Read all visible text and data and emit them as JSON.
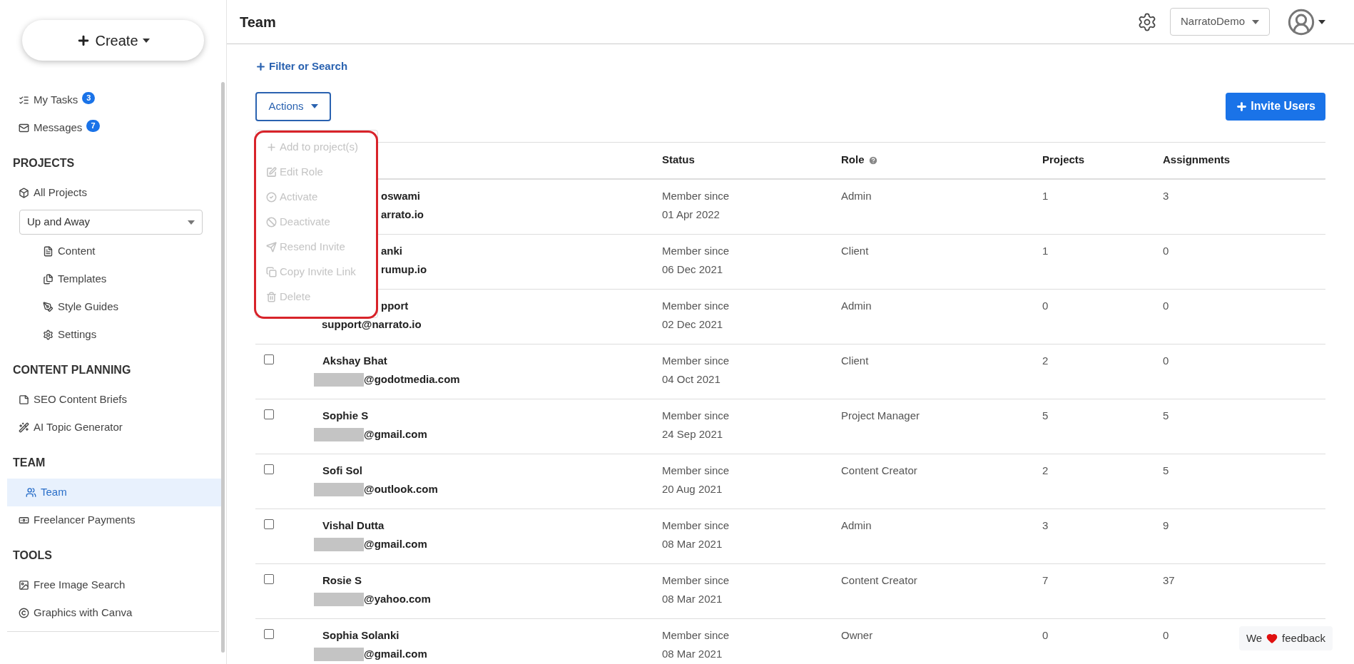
{
  "sidebar": {
    "create_button": "Create",
    "items": [
      {
        "kind": "link",
        "label": "My Tasks",
        "badge": "3",
        "selected": false
      },
      {
        "kind": "link",
        "label": "Messages",
        "badge": "7",
        "selected": false
      },
      {
        "kind": "heading",
        "label": "PROJECTS"
      },
      {
        "kind": "link",
        "label": "All Projects",
        "selected": false
      },
      {
        "kind": "select",
        "value": "Up and Away"
      },
      {
        "kind": "subitem",
        "label": "Content",
        "selected": false
      },
      {
        "kind": "subitem",
        "label": "Templates",
        "selected": false
      },
      {
        "kind": "subitem",
        "label": "Style Guides",
        "selected": false
      },
      {
        "kind": "subitem",
        "label": "Settings",
        "selected": false
      },
      {
        "kind": "heading",
        "label": "CONTENT PLANNING"
      },
      {
        "kind": "link",
        "label": "SEO Content Briefs",
        "selected": false
      },
      {
        "kind": "link",
        "label": "AI Topic Generator",
        "selected": false
      },
      {
        "kind": "heading",
        "label": "TEAM"
      },
      {
        "kind": "link",
        "label": "Team",
        "selected": true
      },
      {
        "kind": "link",
        "label": "Freelancer Payments",
        "selected": false
      },
      {
        "kind": "heading",
        "label": "TOOLS"
      },
      {
        "kind": "link",
        "label": "Free Image Search",
        "selected": false
      },
      {
        "kind": "link",
        "label": "Graphics with Canva",
        "selected": false
      }
    ]
  },
  "header": {
    "title": "Team",
    "workspace": "NarratoDemo"
  },
  "filter_link": "Filter or Search",
  "actions_button": "Actions",
  "invite_button": "Invite Users",
  "actions_menu": {
    "items": [
      {
        "label": "Add to project(s)",
        "disabled": true
      },
      {
        "label": "Edit Role",
        "disabled": true
      },
      {
        "label": "Activate",
        "disabled": true
      },
      {
        "label": "Deactivate",
        "disabled": true
      },
      {
        "label": "Resend Invite",
        "disabled": true
      },
      {
        "label": "Copy Invite Link",
        "disabled": true
      },
      {
        "label": "Delete",
        "disabled": true
      }
    ]
  },
  "table": {
    "columns": [
      "Status",
      "Role",
      "Projects",
      "Assignments"
    ],
    "rows": [
      {
        "name": "oswami",
        "name_clipped": true,
        "email": "arrato.io",
        "email_clipped": true,
        "redacted": false,
        "status": [
          "Member since",
          "01 Apr 2022"
        ],
        "role": "Admin",
        "projects": "1",
        "assignments": "3"
      },
      {
        "name": "anki",
        "name_clipped": true,
        "email": "rumup.io",
        "email_clipped": true,
        "redacted": false,
        "status": [
          "Member since",
          "06 Dec 2021"
        ],
        "role": "Client",
        "projects": "1",
        "assignments": "0"
      },
      {
        "name": "pport",
        "name_clipped": true,
        "email": "support@narrato.io",
        "email_clipped": false,
        "redacted": false,
        "status": [
          "Member since",
          "02 Dec 2021"
        ],
        "role": "Admin",
        "projects": "0",
        "assignments": "0"
      },
      {
        "checked": false,
        "name": "Akshay Bhat",
        "name_clipped": false,
        "email": "@godotmedia.com",
        "email_clipped": false,
        "redacted": true,
        "status": [
          "Member since",
          "04 Oct 2021"
        ],
        "role": "Client",
        "projects": "2",
        "assignments": "0"
      },
      {
        "checked": false,
        "name": "Sophie S",
        "name_clipped": false,
        "email": "@gmail.com",
        "email_clipped": false,
        "redacted": true,
        "status": [
          "Member since",
          "24 Sep 2021"
        ],
        "role": "Project Manager",
        "projects": "5",
        "assignments": "5"
      },
      {
        "checked": false,
        "name": "Sofi Sol",
        "name_clipped": false,
        "email": "@outlook.com",
        "email_clipped": false,
        "redacted": true,
        "status": [
          "Member since",
          "20 Aug 2021"
        ],
        "role": "Content Creator",
        "projects": "2",
        "assignments": "5"
      },
      {
        "checked": false,
        "name": "Vishal Dutta",
        "name_clipped": false,
        "email": "@gmail.com",
        "email_clipped": false,
        "redacted": true,
        "status": [
          "Member since",
          "08 Mar 2021"
        ],
        "role": "Admin",
        "projects": "3",
        "assignments": "9"
      },
      {
        "checked": false,
        "name": "Rosie S",
        "name_clipped": false,
        "email": "@yahoo.com",
        "email_clipped": false,
        "redacted": true,
        "status": [
          "Member since",
          "08 Mar 2021"
        ],
        "role": "Content Creator",
        "projects": "7",
        "assignments": "37"
      },
      {
        "checked": false,
        "name": "Sophia Solanki",
        "name_clipped": false,
        "email": "@gmail.com",
        "email_clipped": false,
        "redacted": true,
        "status": [
          "Member since",
          "08 Mar 2021"
        ],
        "role": "Owner",
        "projects": "0",
        "assignments": "0"
      }
    ]
  },
  "feedback": {
    "before": "We",
    "after": "feedback"
  }
}
